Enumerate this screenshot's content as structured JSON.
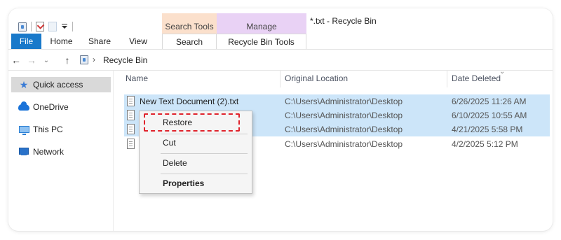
{
  "window": {
    "title": "*.txt - Recycle Bin"
  },
  "ribbon": {
    "contextual_groups": {
      "search_tools": "Search Tools",
      "manage": "Manage"
    },
    "tabs": {
      "file": "File",
      "home": "Home",
      "share": "Share",
      "view": "View",
      "search": "Search",
      "recycle_bin_tools": "Recycle Bin Tools"
    }
  },
  "address_bar": {
    "path": "Recycle Bin"
  },
  "nav_pane": {
    "items": [
      {
        "label": "Quick access",
        "icon": "star-icon",
        "selected": true
      },
      {
        "label": "OneDrive",
        "icon": "cloud-icon",
        "selected": false
      },
      {
        "label": "This PC",
        "icon": "computer-icon",
        "selected": false
      },
      {
        "label": "Network",
        "icon": "network-icon",
        "selected": false
      }
    ]
  },
  "file_list": {
    "columns": {
      "name": "Name",
      "original_location": "Original Location",
      "date_deleted": "Date Deleted"
    },
    "rows": [
      {
        "name": "New Text Document (2).txt",
        "location": "C:\\Users\\Administrator\\Desktop",
        "date": "6/26/2025 11:26 AM",
        "selected": true
      },
      {
        "name": "",
        "location": "C:\\Users\\Administrator\\Desktop",
        "date": "6/10/2025 10:55 AM",
        "selected": true
      },
      {
        "name": "",
        "location": "C:\\Users\\Administrator\\Desktop",
        "date": "4/21/2025 5:58 PM",
        "selected": true
      },
      {
        "name": "",
        "location": "C:\\Users\\Administrator\\Desktop",
        "date": "4/2/2025 5:12 PM",
        "selected": false
      }
    ]
  },
  "context_menu": {
    "restore": "Restore",
    "cut": "Cut",
    "delete": "Delete",
    "properties": "Properties"
  },
  "colors": {
    "file_tab": "#1979ca",
    "selection": "#cce5f9",
    "search_tools": "#fbe0cc",
    "manage": "#e9d2f5",
    "highlight_box": "#e0232c"
  }
}
